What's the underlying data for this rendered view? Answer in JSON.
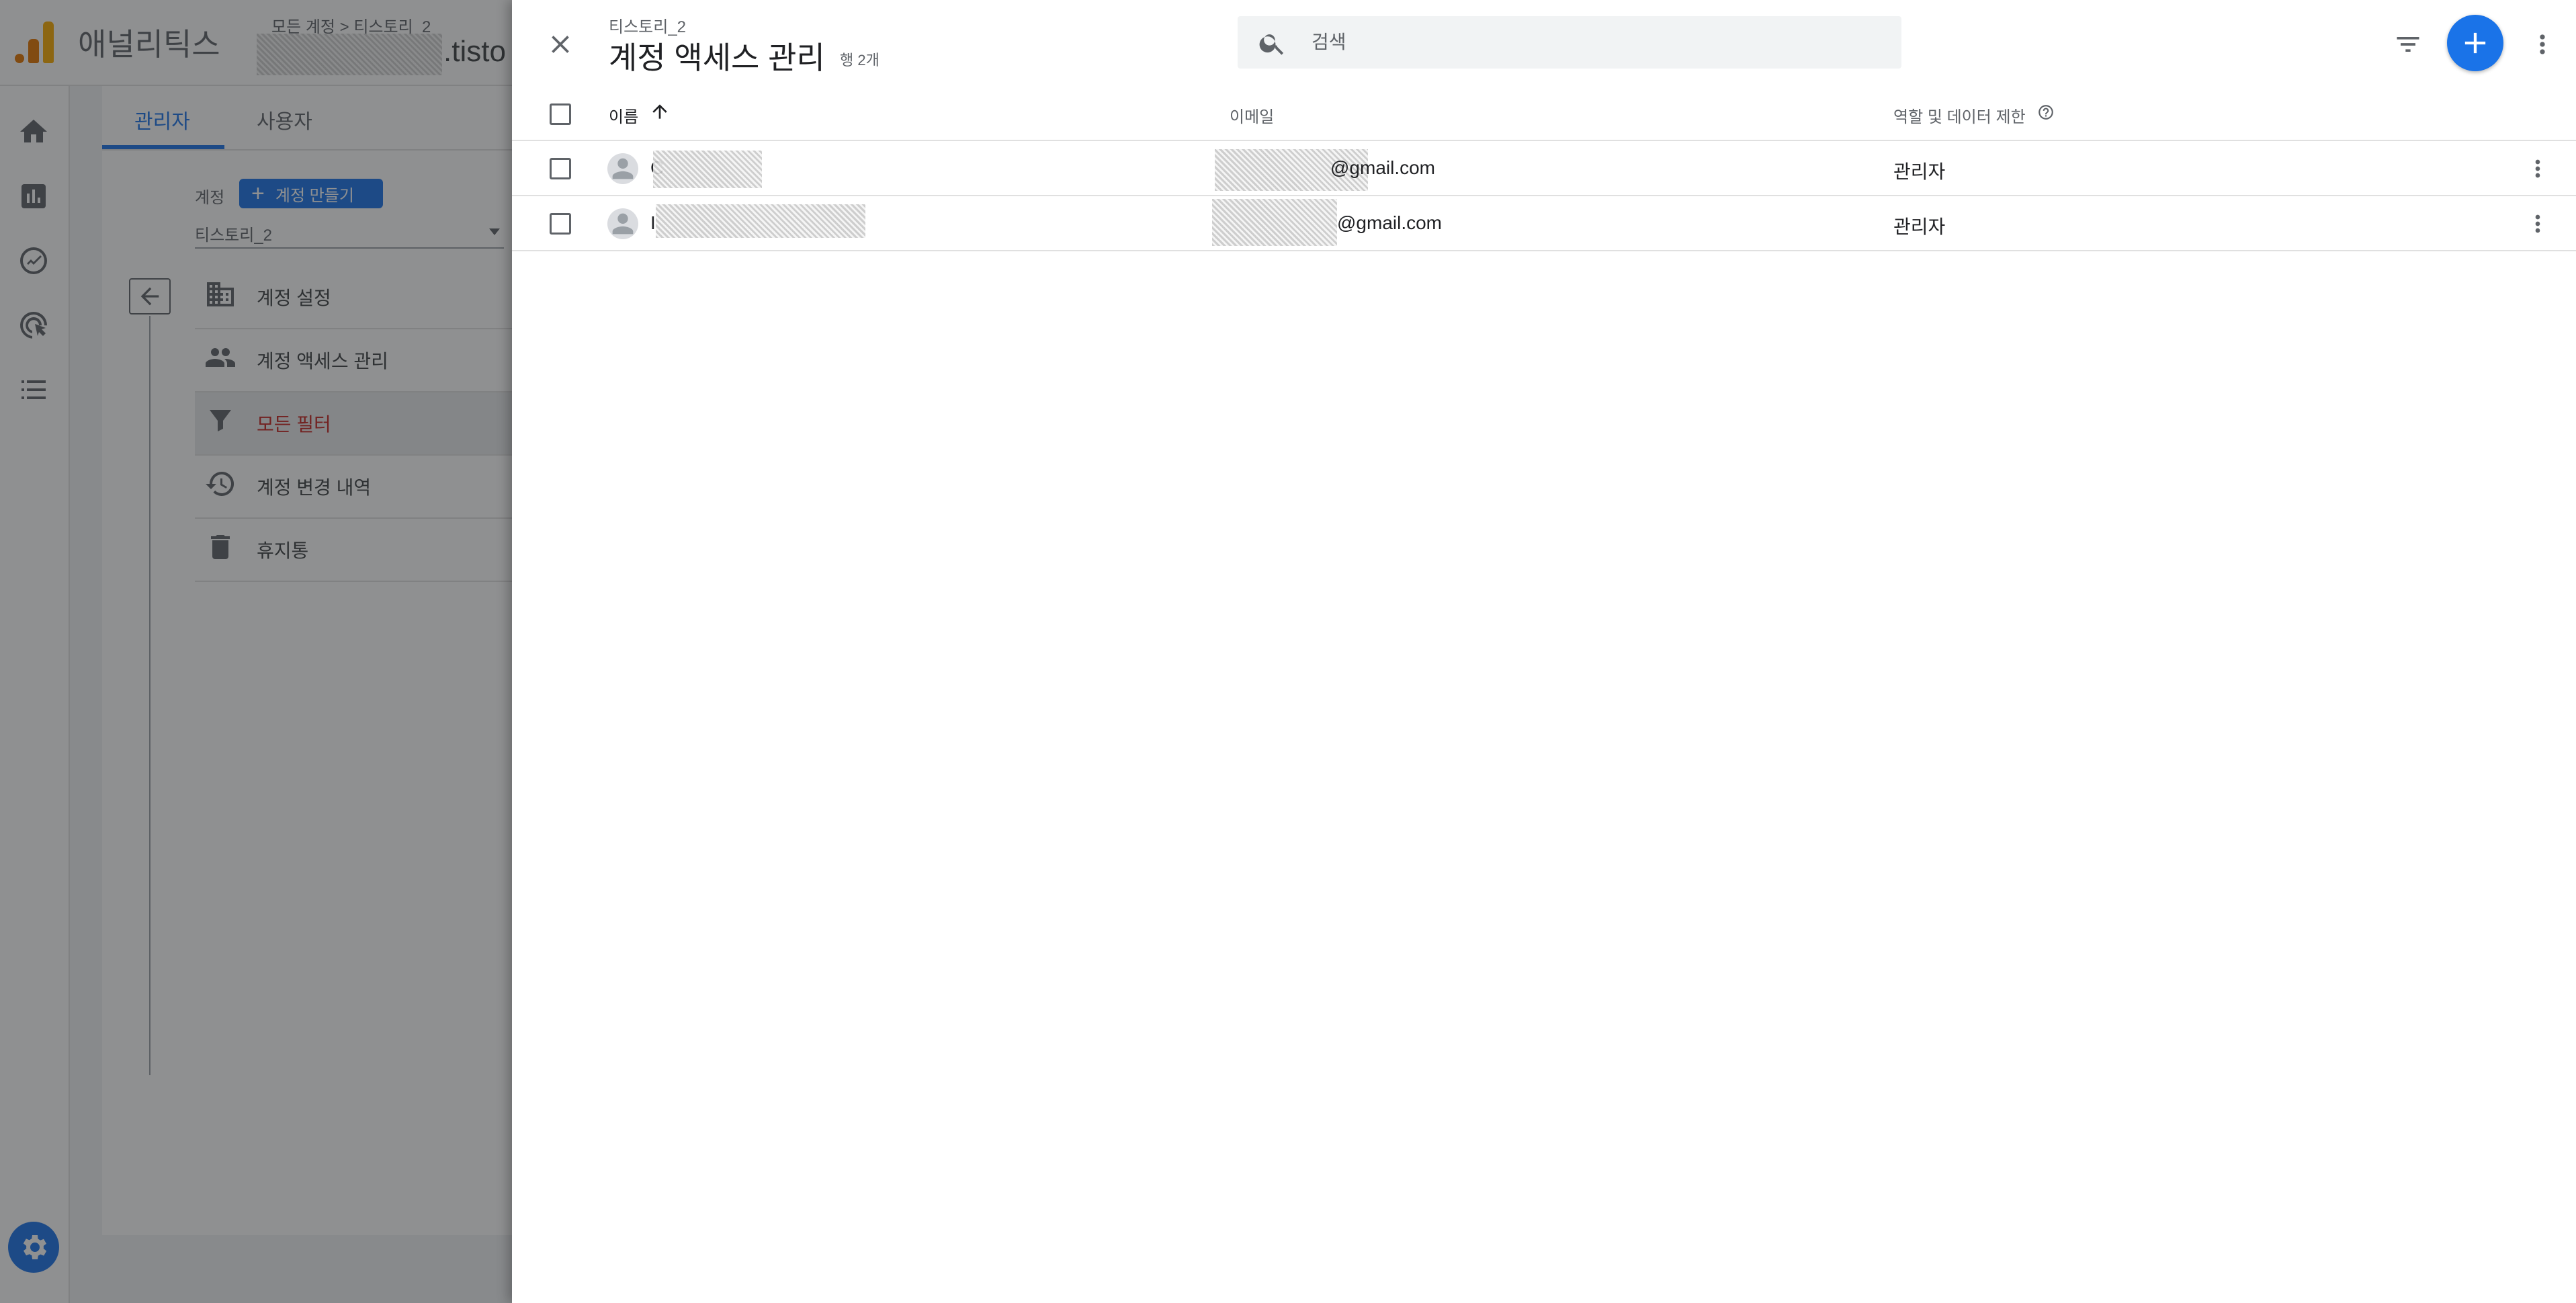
{
  "app": {
    "name": "애널리틱스",
    "breadcrumb": "모든 계정 > 티스토리_2",
    "property_suffix": ".tisto"
  },
  "admin": {
    "tabs": [
      {
        "label": "관리자",
        "active": true
      },
      {
        "label": "사용자",
        "active": false
      }
    ],
    "account_label": "계정",
    "create_account_label": "계정 만들기",
    "selected_account": "티스토리_2",
    "menu": [
      {
        "label": "계정 설정",
        "icon": "building-icon"
      },
      {
        "label": "계정 액세스 관리",
        "icon": "people-icon"
      },
      {
        "label": "모든 필터",
        "icon": "filter-icon",
        "active": true
      },
      {
        "label": "계정 변경 내역",
        "icon": "history-icon"
      },
      {
        "label": "휴지통",
        "icon": "trash-icon"
      }
    ]
  },
  "drawer": {
    "subtitle": "티스토리_2",
    "title": "계정 액세스 관리",
    "row_count": "행 2개",
    "search_placeholder": "검색",
    "columns": {
      "name": "이름",
      "email": "이메일",
      "role": "역할 및 데이터 제한"
    },
    "rows": [
      {
        "name_initial": "C",
        "email_suffix": "@gmail.com",
        "role": "관리자"
      },
      {
        "name_initial": "I",
        "email_suffix": "@gmail.com",
        "role": "관리자"
      }
    ]
  },
  "colors": {
    "accent": "#1a73e8",
    "active_menu_text": "#c5221f",
    "logo_orange": "#e37400",
    "logo_yellow": "#f9ab00"
  }
}
